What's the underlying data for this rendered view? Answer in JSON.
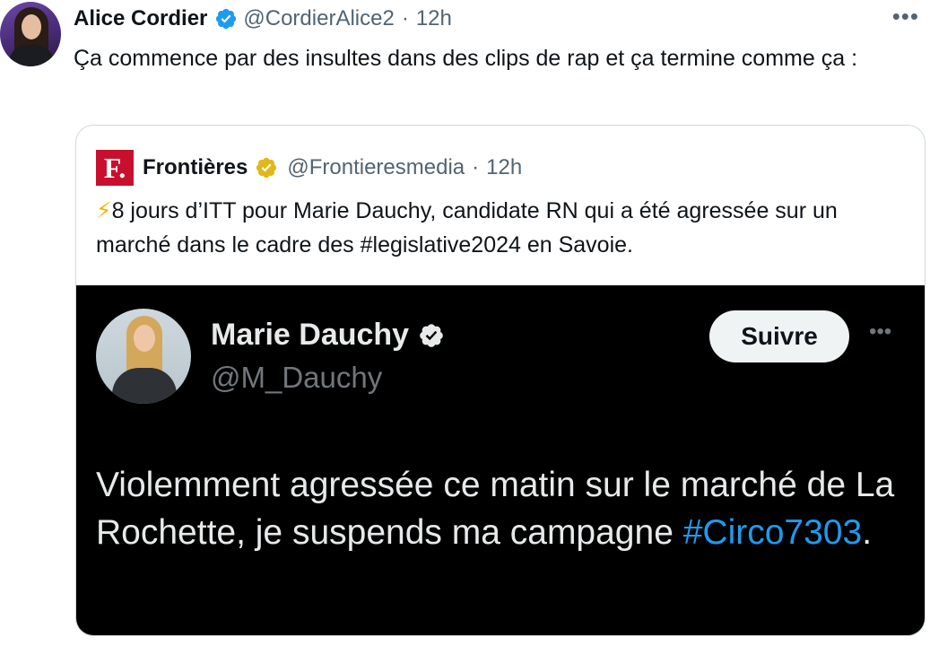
{
  "tweet": {
    "author_name": "Alice Cordier",
    "author_handle": "@CordierAlice2",
    "separator": "·",
    "time": "12h",
    "more_glyph": "•••",
    "text": "Ça commence par des insultes dans des clips de rap et ça termine comme ça :"
  },
  "quote": {
    "logo_letter": "F.",
    "author_name": "Frontières",
    "author_handle": "@Frontieresmedia",
    "separator": "·",
    "time": "12h",
    "bolt": "⚡",
    "text": "8 jours d’ITT pour Marie Dauchy, candidate RN qui a été agressée sur un marché dans le cadre des #legislative2024 en Savoie."
  },
  "media": {
    "name": "Marie Dauchy",
    "handle": "@M_Dauchy",
    "follow_label": "Suivre",
    "more_glyph": "•••",
    "text_before": "Violemment agressée ce matin sur le marché de La Rochette, je suspends ma campagne ",
    "hashtag": "#Circo7303",
    "text_after": "."
  },
  "colors": {
    "verified_blue": "#1d9bf0",
    "verified_gold": "#e2b719",
    "logo_red": "#c8102e",
    "muted_text": "#536471",
    "media_background": "#000000"
  },
  "icons": [
    "verified-badge-icon",
    "gold-verified-badge-icon",
    "more-options-icon",
    "lightning-emoji-icon"
  ]
}
